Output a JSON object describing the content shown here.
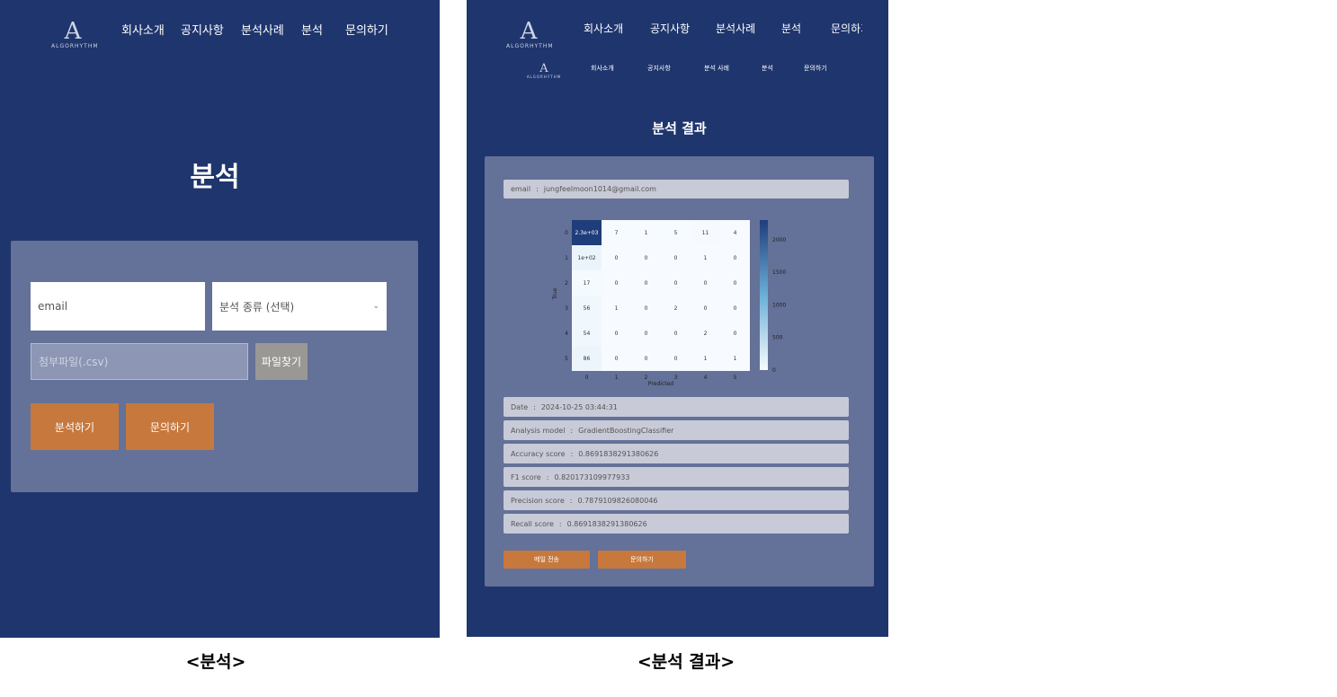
{
  "left": {
    "logo": {
      "mark": "A",
      "word": "ALGORHYTHM"
    },
    "nav": [
      "회사소개",
      "공지사항",
      "분석사례",
      "분석",
      "문의하기"
    ],
    "title": "분석",
    "form": {
      "email_placeholder": "email",
      "select_value": "분석 종류 (선택)",
      "file_placeholder": "첨부파일(.csv)",
      "browse_label": "파일찾기",
      "analyze_label": "분석하기",
      "inquiry_label": "문의하기"
    },
    "caption": "<분석>"
  },
  "right": {
    "logo": {
      "mark": "A",
      "word": "ALGORHYTHM"
    },
    "nav": [
      "회사소개",
      "공지사항",
      "분석사례",
      "분석",
      "문의하기"
    ],
    "nav_small": [
      "회사소개",
      "공지사항",
      "분석 사례",
      "분석",
      "문의하기"
    ],
    "title": "분석 결과",
    "email_label": "email",
    "email_value": "jungfeelmoon1014@gmail.com",
    "rows": [
      {
        "label": "Date",
        "value": "2024-10-25 03:44:31"
      },
      {
        "label": "Analysis model",
        "value": "GradientBoostingClassifier"
      },
      {
        "label": "Accuracy score",
        "value": "0.8691838291380626"
      },
      {
        "label": "F1 score",
        "value": "0.820173109977933"
      },
      {
        "label": "Precision score",
        "value": "0.7879109826080046"
      },
      {
        "label": "Recall score",
        "value": "0.8691838291380626"
      }
    ],
    "mail_button": "메일 전송",
    "inquiry_button": "문의하기",
    "caption": "<분석 결과>"
  },
  "chart_data": {
    "type": "heatmap",
    "x_categories": [
      "0",
      "1",
      "2",
      "3",
      "4",
      "5"
    ],
    "y_categories": [
      "0",
      "1",
      "2",
      "3",
      "4",
      "5"
    ],
    "cell_labels": [
      [
        "2.3e+03",
        "7",
        "1",
        "5",
        "11",
        "4"
      ],
      [
        "1e+02",
        "0",
        "0",
        "0",
        "1",
        "0"
      ],
      [
        "17",
        "0",
        "0",
        "0",
        "0",
        "0"
      ],
      [
        "56",
        "1",
        "0",
        "2",
        "0",
        "0"
      ],
      [
        "54",
        "0",
        "0",
        "0",
        "2",
        "0"
      ],
      [
        "86",
        "0",
        "0",
        "0",
        "1",
        "1"
      ]
    ],
    "values": [
      [
        2300,
        7,
        1,
        5,
        11,
        4
      ],
      [
        100,
        0,
        0,
        0,
        1,
        0
      ],
      [
        17,
        0,
        0,
        0,
        0,
        0
      ],
      [
        56,
        1,
        0,
        2,
        0,
        0
      ],
      [
        54,
        0,
        0,
        0,
        2,
        0
      ],
      [
        86,
        0,
        0,
        0,
        1,
        1
      ]
    ],
    "xlabel": "Predicted",
    "ylabel": "True",
    "colorbar_ticks": [
      "0",
      "500",
      "1000",
      "1500",
      "2000"
    ],
    "colorbar_range": [
      0,
      2300
    ],
    "colors": {
      "low": "#f7fbff",
      "high": "#1f3d7a"
    }
  }
}
